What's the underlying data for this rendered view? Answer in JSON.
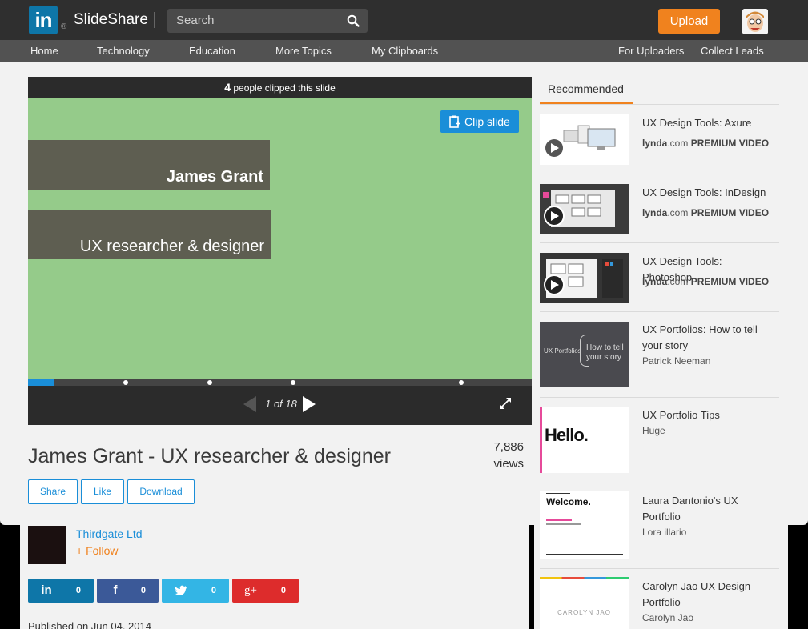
{
  "header": {
    "logo_mark": "in",
    "logo_reg": "®",
    "brand": "SlideShare",
    "search_placeholder": "Search",
    "upload_label": "Upload"
  },
  "nav": {
    "left": [
      "Home",
      "Technology",
      "Education",
      "More Topics",
      "My Clipboards"
    ],
    "right": [
      "For Uploaders",
      "Collect Leads"
    ]
  },
  "player": {
    "clip_count": "4",
    "clip_text": " people clipped this slide",
    "clip_button": "Clip slide",
    "slide_line1": "James Grant",
    "slide_line2": "UX researcher & designer",
    "page_label": "1 of 18",
    "current_page": 1,
    "total_pages": 18
  },
  "presentation": {
    "title": "James Grant - UX researcher & designer",
    "views_count": "7,886",
    "views_label": "views",
    "buttons": [
      "Share",
      "Like",
      "Download"
    ],
    "author": "Thirdgate Ltd",
    "follow_label": "+ Follow",
    "published": "Published on Jun 04, 2014"
  },
  "share": [
    {
      "network": "in",
      "count": "0",
      "color": "#0e76a8"
    },
    {
      "network": "f",
      "count": "0",
      "color": "#3b5998"
    },
    {
      "network": "t",
      "count": "0",
      "color": "#33b5e5"
    },
    {
      "network": "g+",
      "count": "0",
      "color": "#dd2c2c"
    }
  ],
  "recommended": {
    "heading": "Recommended",
    "items": [
      {
        "title": "UX Design Tools: Axure",
        "sub_a": "lynda",
        "sub_b": ".com",
        "sub_c": " PREMIUM VIDEO"
      },
      {
        "title": "UX Design Tools: InDesign",
        "sub_a": "lynda",
        "sub_b": ".com",
        "sub_c": " PREMIUM VIDEO"
      },
      {
        "title": "UX Design Tools: Photoshop",
        "sub_a": "lynda",
        "sub_b": ".com",
        "sub_c": " PREMIUM VIDEO"
      },
      {
        "title": "UX Portfolios: How to tell your story",
        "sub": "Patrick Neeman",
        "thumb_left": "UX Portfolios",
        "thumb_right": "How to tell your story"
      },
      {
        "title": "UX Portfolio Tips",
        "sub": "Huge",
        "thumb_text": "Hello."
      },
      {
        "title": "Laura Dantonio's UX Portfolio",
        "sub": "Lora illario",
        "thumb_text": "Welcome."
      },
      {
        "title": "Carolyn Jao UX Design Portfolio",
        "sub": "Carolyn Jao",
        "thumb_text": "CAROLYN JAO"
      }
    ]
  },
  "colors": {
    "accent": "#1a8ed8",
    "orange": "#f0821e",
    "slide_bg": "#95cb8a"
  }
}
